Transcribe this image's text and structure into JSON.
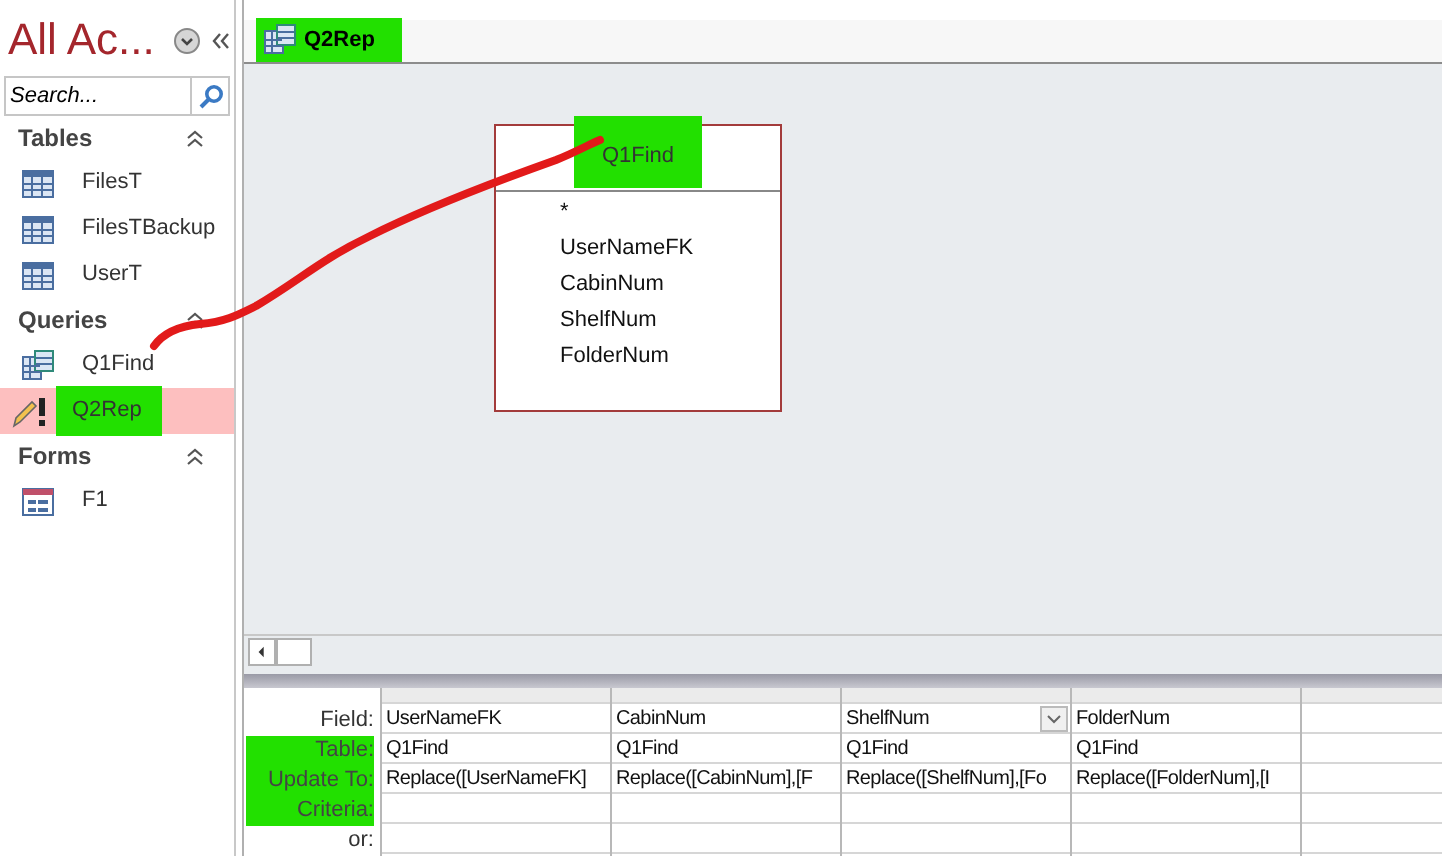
{
  "nav": {
    "title": "All Ac...",
    "search": {
      "placeholder": "Search..."
    },
    "groups": [
      {
        "label": "Tables",
        "expanded": true,
        "items": [
          {
            "label": "FilesT",
            "kind": "table",
            "selected": false,
            "highlighted": false
          },
          {
            "label": "FilesTBackup",
            "kind": "table",
            "selected": false,
            "highlighted": false
          },
          {
            "label": "UserT",
            "kind": "table",
            "selected": false,
            "highlighted": false
          }
        ]
      },
      {
        "label": "Queries",
        "expanded": true,
        "items": [
          {
            "label": "Q1Find",
            "kind": "query",
            "selected": false,
            "highlighted": false
          },
          {
            "label": "Q2Rep",
            "kind": "update",
            "selected": true,
            "highlighted": true
          }
        ]
      },
      {
        "label": "Forms",
        "expanded": true,
        "items": [
          {
            "label": "F1",
            "kind": "form",
            "selected": false,
            "highlighted": false
          }
        ]
      }
    ]
  },
  "tab": {
    "label": "Q2Rep",
    "highlighted": true
  },
  "table_box": {
    "title": "Q1Find",
    "highlighted": true,
    "fields": [
      "*",
      "UserNameFK",
      "CabinNum",
      "ShelfNum",
      "FolderNum"
    ]
  },
  "grid": {
    "row_labels": [
      {
        "label": "Field:",
        "highlighted": false
      },
      {
        "label": "Table:",
        "highlighted": true
      },
      {
        "label": "Update To:",
        "highlighted": true
      },
      {
        "label": "Criteria:",
        "highlighted": true
      },
      {
        "label": "or:",
        "highlighted": false
      }
    ],
    "columns": [
      {
        "field": "UserNameFK",
        "table": "Q1Find",
        "update_to": "Replace([UserNameFK]",
        "focused": false
      },
      {
        "field": "CabinNum",
        "table": "Q1Find",
        "update_to": "Replace([CabinNum],[F",
        "focused": false
      },
      {
        "field": "ShelfNum",
        "table": "Q1Find",
        "update_to": "Replace([ShelfNum],[Fo",
        "focused": true
      },
      {
        "field": "FolderNum",
        "table": "Q1Find",
        "update_to": "Replace([FolderNum],[I",
        "focused": false
      }
    ]
  }
}
